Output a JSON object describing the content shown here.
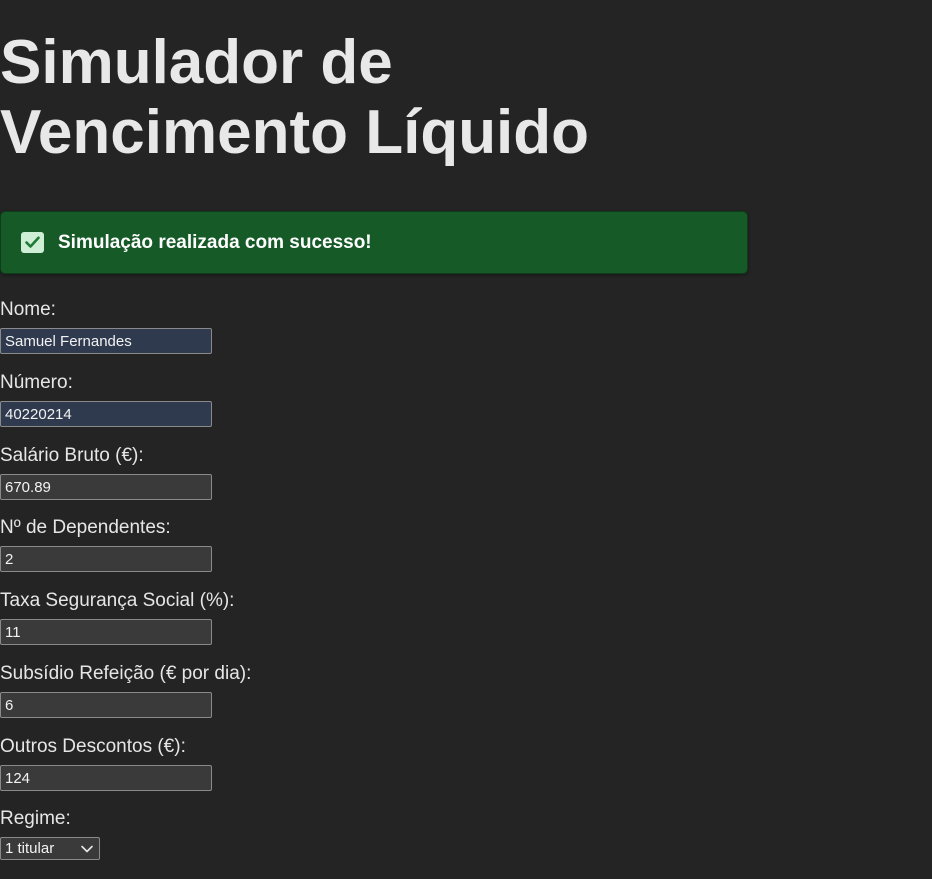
{
  "title": "Simulador de Vencimento Líquido",
  "alert": {
    "message": "Simulação realizada com sucesso!",
    "color": "#165a27"
  },
  "form": {
    "nome": {
      "label": "Nome:",
      "value": "Samuel Fernandes"
    },
    "numero": {
      "label": "Número:",
      "value": "40220214"
    },
    "salario": {
      "label": "Salário Bruto (€):",
      "value": "670.89"
    },
    "dependentes": {
      "label": "Nº de Dependentes:",
      "value": "2"
    },
    "taxa": {
      "label": "Taxa Segurança Social (%):",
      "value": "11"
    },
    "subsidio": {
      "label": "Subsídio Refeição (€ por dia):",
      "value": "6"
    },
    "descontos": {
      "label": "Outros Descontos (€):",
      "value": "124"
    },
    "regime": {
      "label": "Regime:",
      "selected": "1 titular"
    }
  },
  "colors": {
    "background": "#242424",
    "autofill_input": "#2f3a4e",
    "input": "#3a3a3a"
  }
}
